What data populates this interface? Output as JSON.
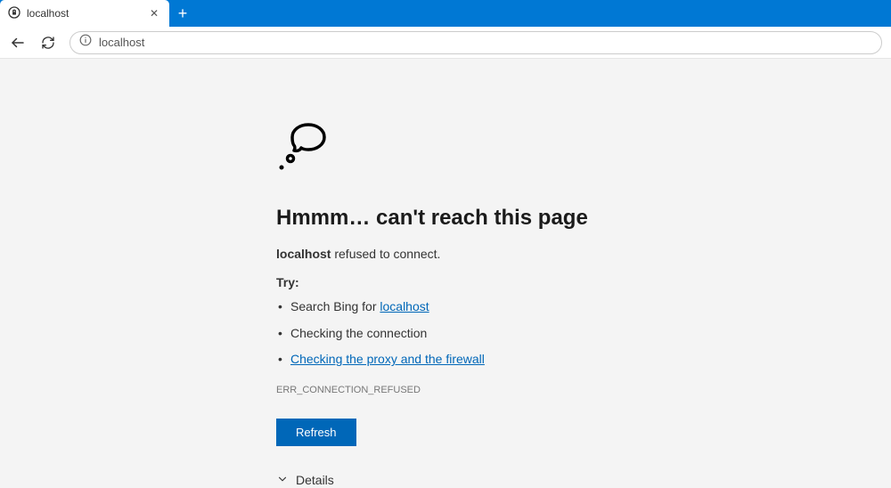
{
  "tab": {
    "title": "localhost"
  },
  "address": {
    "url": "localhost"
  },
  "error": {
    "headline": "Hmmm… can't reach this page",
    "host": "localhost",
    "refused_suffix": " refused to connect.",
    "try_label": "Try:",
    "suggestion1_prefix": "Search Bing for ",
    "suggestion1_link": "localhost",
    "suggestion2": "Checking the connection",
    "suggestion3_link": "Checking the proxy and the firewall",
    "code": "ERR_CONNECTION_REFUSED",
    "refresh_label": "Refresh",
    "details_label": "Details"
  }
}
